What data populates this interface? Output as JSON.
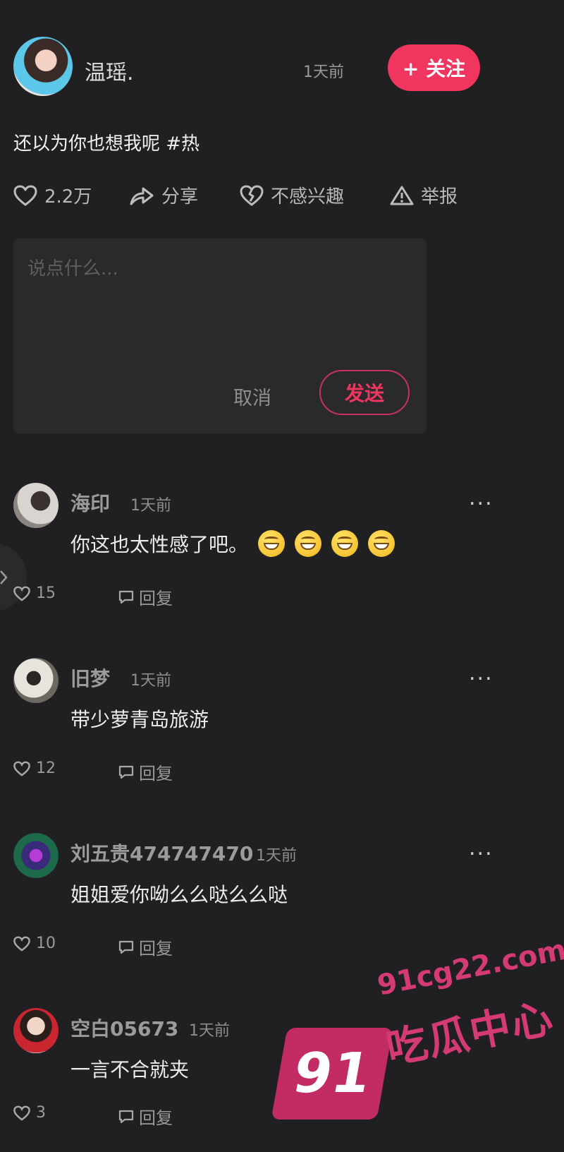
{
  "post": {
    "author": "温瑶.",
    "time": "1天前",
    "follow_label": "+ 关注",
    "text": "还以为你也想我呢 #热"
  },
  "actions": {
    "like_count": "2.2万",
    "share_label": "分享",
    "uninterested_label": "不感兴趣",
    "report_label": "举报"
  },
  "comment_box": {
    "placeholder": "说点什么...",
    "cancel_label": "取消",
    "send_label": "发送"
  },
  "comments": [
    {
      "name": "海印",
      "time": "1天前",
      "text": "你这也太性感了吧。",
      "emoji_count": 4,
      "likes": "15",
      "reply_label": "回复",
      "more": "..."
    },
    {
      "name": "旧梦",
      "time": "1天前",
      "text": "带少萝青岛旅游",
      "emoji_count": 0,
      "likes": "12",
      "reply_label": "回复",
      "more": "..."
    },
    {
      "name": "刘五贵474747470",
      "time": "1天前",
      "text": "姐姐爱你呦么么哒么么哒",
      "emoji_count": 0,
      "likes": "10",
      "reply_label": "回复",
      "more": "..."
    },
    {
      "name": "空白05673",
      "time": "1天前",
      "text": "一言不合就夹",
      "emoji_count": 0,
      "likes": "3",
      "reply_label": "回复",
      "more": "..."
    }
  ],
  "watermark": {
    "badge": "91",
    "domain": "91cg22.com",
    "name": "吃瓜中心"
  },
  "colors": {
    "accent": "#f0355e",
    "background": "#202022",
    "watermark": "#d43a73"
  }
}
